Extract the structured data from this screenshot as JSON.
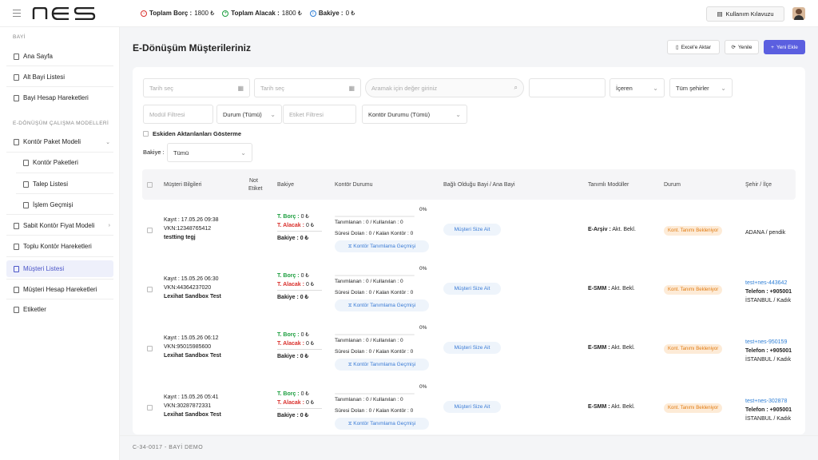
{
  "topbar": {
    "logo": "nes",
    "debt_label": "Toplam Borç :",
    "debt_value": "1800 ₺",
    "credit_label": "Toplam Alacak :",
    "credit_value": "1800 ₺",
    "balance_label": "Bakiye :",
    "balance_value": "0 ₺",
    "guide_button": "Kullanım Kılavuzu"
  },
  "sidebar": {
    "section_dealer": "BAYİ",
    "home": "Ana Sayfa",
    "sub_dealers": "Alt Bayi Listesi",
    "dealer_account": "Bayi Hesap Hareketleri",
    "section_models": "E-DÖNÜŞÜM ÇALIŞMA MODELLERİ",
    "kontor_package_model": "Kontör Paket Modeli",
    "kontor_packages": "Kontör Paketleri",
    "request_list": "Talep Listesi",
    "transaction_history": "İşlem Geçmişi",
    "fixed_price_model": "Sabit Kontör Fiyat Modeli",
    "bulk_kontor": "Toplu Kontör Hareketleri",
    "customer_list": "Müşteri Listesi",
    "customer_account": "Müşteri Hesap Hareketleri",
    "tags": "Etiketler"
  },
  "page": {
    "title": "E-Dönüşüm Müşterileriniz",
    "export_button": "Excel'e Aktar",
    "refresh_button": "Yenile",
    "add_button": "Yeni Ekle"
  },
  "filters": {
    "date_from": "Tarih seç",
    "date_to": "Tarih seç",
    "search": "Aramak için değer giriniz",
    "contains": "İçeren",
    "cities": "Tüm şehirler",
    "module": "Modül Filtresi",
    "status": "Durum (Tümü)",
    "tag": "Etiket Filtresi",
    "kontor_status": "Kontör Durumu (Tümü)",
    "hide_old": "Eskiden Aktarılanları Gösterme",
    "balance_label": "Bakiye :",
    "balance_value": "Tümü"
  },
  "table": {
    "headers": [
      "Müşteri Bilgileri",
      "Not",
      "Etiket",
      "Bakiye",
      "Kontör Durumu",
      "Bağlı Olduğu Bayi / Ana Bayi",
      "Tanımlı Modüller",
      "Durum",
      "Şehir / İlçe"
    ],
    "rows": [
      {
        "kayit": "Kayıt : 17.05.26 09:38",
        "vkn": "VKN:12348765412",
        "name": "testting tegj",
        "borc_label": "T. Borç :",
        "borc": "0 ₺",
        "alacak_label": "T. Alacak :",
        "alacak": "0 ₺",
        "bakiye": "Bakiye : 0 ₺",
        "percent": "0%",
        "tanimlanan": "Tanımlanan : 0 / Kullanılan : 0",
        "suresi": "Süresi Dolan : 0 / Kalan Kontör : 0",
        "history": "Kontör Tanımlama Geçmişi",
        "dealer": "Müşteri Size Ait",
        "module_name": "E-Arşiv :",
        "module_status": "Akt. Bekl.",
        "status": "Kont. Tanımı Bekleniyor",
        "city1": "ADANA / pendik",
        "city2": "",
        "city3": ""
      },
      {
        "kayit": "Kayıt : 15.05.26 06:30",
        "vkn": "VKN:44364237020",
        "name": "Lexihat Sandbox Test",
        "borc_label": "T. Borç :",
        "borc": "0 ₺",
        "alacak_label": "T. Alacak :",
        "alacak": "0 ₺",
        "bakiye": "Bakiye : 0 ₺",
        "percent": "0%",
        "tanimlanan": "Tanımlanan : 0 / Kullanılan : 0",
        "suresi": "Süresi Dolan : 0 / Kalan Kontör : 0",
        "history": "Kontör Tanımlama Geçmişi",
        "dealer": "Müşteri Size Ait",
        "module_name": "E-SMM :",
        "module_status": "Akt. Bekl.",
        "status": "Kont. Tanımı Bekleniyor",
        "city1": "test+nes-443642",
        "city2": "Telefon : +905001",
        "city3": "İSTANBUL / Kadık"
      },
      {
        "kayit": "Kayıt : 15.05.26 06:12",
        "vkn": "VKN:95015985600",
        "name": "Lexihat Sandbox Test",
        "borc_label": "T. Borç :",
        "borc": "0 ₺",
        "alacak_label": "T. Alacak :",
        "alacak": "0 ₺",
        "bakiye": "Bakiye : 0 ₺",
        "percent": "0%",
        "tanimlanan": "Tanımlanan : 0 / Kullanılan : 0",
        "suresi": "Süresi Dolan : 0 / Kalan Kontör : 0",
        "history": "Kontör Tanımlama Geçmişi",
        "dealer": "Müşteri Size Ait",
        "module_name": "E-SMM :",
        "module_status": "Akt. Bekl.",
        "status": "Kont. Tanımı Bekleniyor",
        "city1": "test+nes-950159",
        "city2": "Telefon : +905001",
        "city3": "İSTANBUL / Kadık"
      },
      {
        "kayit": "Kayıt : 15.05.26 05:41",
        "vkn": "VKN:30287872331",
        "name": "Lexihat Sandbox Test",
        "borc_label": "T. Borç :",
        "borc": "0 ₺",
        "alacak_label": "T. Alacak :",
        "alacak": "0 ₺",
        "bakiye": "Bakiye : 0 ₺",
        "percent": "0%",
        "tanimlanan": "Tanımlanan : 0 / Kullanılan : 0",
        "suresi": "Süresi Dolan : 0 / Kalan Kontör : 0",
        "history": "Kontör Tanımlama Geçmişi",
        "dealer": "Müşteri Size Ait",
        "module_name": "E-SMM :",
        "module_status": "Akt. Bekl.",
        "status": "Kont. Tanımı Bekleniyor",
        "city1": "test+nes-302878",
        "city2": "Telefon : +905001",
        "city3": "İSTANBUL / Kadık"
      }
    ]
  },
  "footer": {
    "text": "C-34-0017 - BAYİ DEMO"
  }
}
